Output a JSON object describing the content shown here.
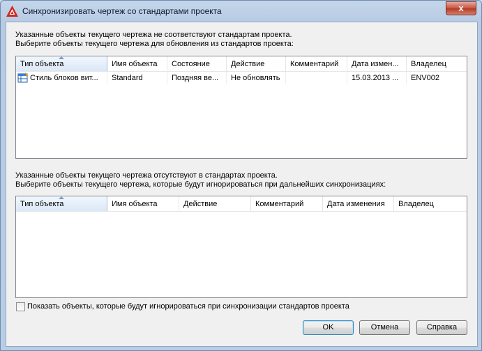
{
  "window": {
    "title": "Синхронизировать чертеж со стандартами проекта",
    "close_label": "x"
  },
  "section1": {
    "line1": "Указанные объекты текущего чертежа не соответствуют стандартам проекта.",
    "line2": "Выберите объекты текущего чертежа для обновления из стандартов проекта:",
    "columns": [
      "Тип объекта",
      "Имя объекта",
      "Состояние",
      "Действие",
      "Комментарий",
      "Дата измен...",
      "Владелец"
    ],
    "rows": [
      {
        "type": "Стиль блоков вит...",
        "name": "Standard",
        "state": "Поздняя ве...",
        "action": "Не обновлять",
        "comment": "",
        "date": "15.03.2013 ...",
        "owner": "ENV002"
      }
    ]
  },
  "section2": {
    "line1": "Указанные объекты текущего чертежа отсутствуют в стандартах проекта.",
    "line2": "Выберите объекты текущего чертежа, которые будут игнорироваться при дальнейших синхронизациях:",
    "columns": [
      "Тип объекта",
      "Имя объекта",
      "Действие",
      "Комментарий",
      "Дата изменения",
      "Владелец"
    ]
  },
  "show_ignored": {
    "label": "Показать объекты, которые будут игнорироваться при синхронизации стандартов проекта",
    "checked": false
  },
  "buttons": {
    "ok": "OK",
    "cancel": "Отмена",
    "help": "Справка"
  },
  "colors": {
    "accent": "#3c7fb1",
    "app_icon_red": "#d0261d",
    "close_red": "#c7523c"
  }
}
